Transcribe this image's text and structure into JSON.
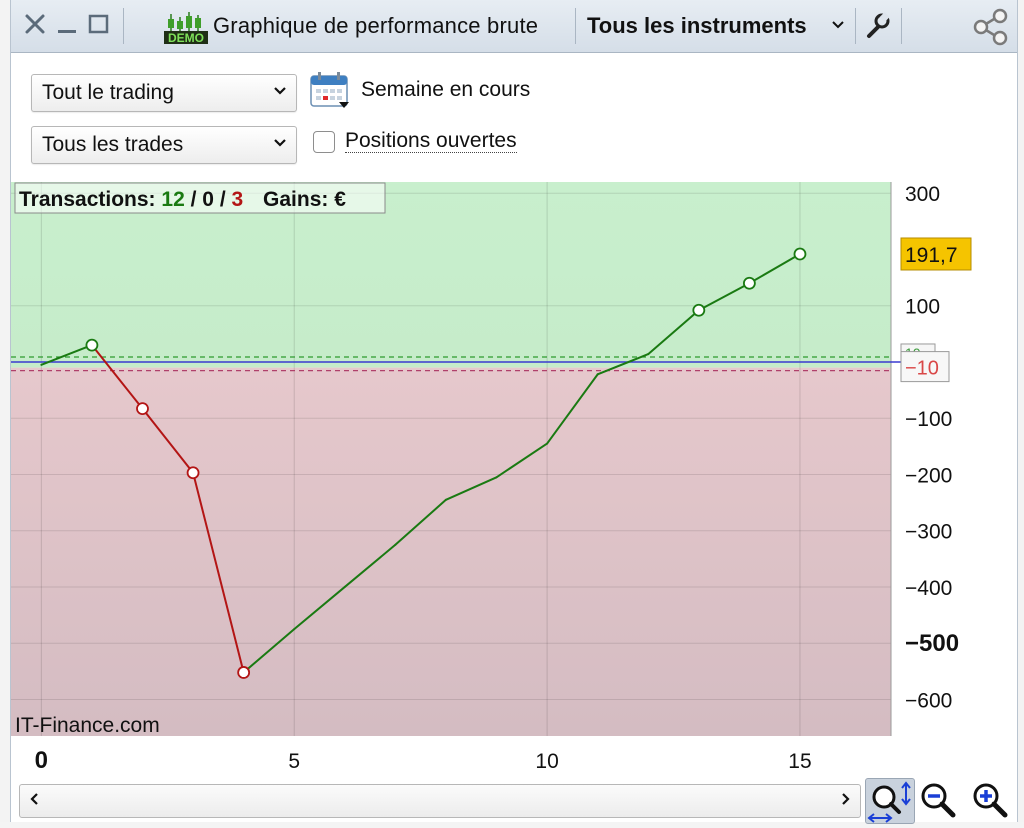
{
  "titlebar": {
    "title": "Graphique de performance brute",
    "instrument_label": "Tous les instruments",
    "demo_badge": "DEMO"
  },
  "controls": {
    "trading_select": "Tout le trading",
    "trades_select": "Tous les trades",
    "period_label": "Semaine en cours",
    "open_positions_label": "Positions ouvertes",
    "open_positions_checked": false
  },
  "summary": {
    "transactions_label": "Transactions:",
    "winning": "12",
    "neutral": "0",
    "losing": "3",
    "separator": "/",
    "gains_label": "Gains: €"
  },
  "watermark": "IT-Finance.com",
  "colors": {
    "profit_zone": "#c8efcd",
    "loss_zone": "#dcc2c8",
    "gain_line": "#1a7a12",
    "loss_line": "#b31515",
    "last_value_badge": "#f5c400",
    "reference_line": "#3a3ad0"
  },
  "chart_data": {
    "type": "line",
    "xlabel": "",
    "ylabel": "",
    "xlim": [
      -0.6,
      16.8
    ],
    "ylim": [
      -665,
      320
    ],
    "x_ticks": [
      "0",
      "5",
      "10",
      "15"
    ],
    "y_ticks": [
      "300",
      "100",
      "-100",
      "-200",
      "-300",
      "-400",
      "-500",
      "-600"
    ],
    "bold_x_ticks": [
      "0"
    ],
    "bold_y_ticks": [
      "-500"
    ],
    "grid": true,
    "series": [
      {
        "x": [
          0,
          1,
          2,
          3,
          4,
          5,
          6,
          7,
          8,
          9,
          10,
          11,
          12,
          13,
          14,
          15
        ],
        "y": [
          -5,
          30,
          -83,
          -197,
          -552,
          -475,
          -400,
          -325,
          -245,
          -205,
          -145,
          -22,
          14,
          92,
          140,
          192
        ]
      }
    ],
    "markers_x": [
      1,
      2,
      3,
      4,
      13,
      14,
      15
    ],
    "last_value": "191,7",
    "reference_value": "-10",
    "reference_label": "-10",
    "zero_line": 0,
    "hidden_badge": "10"
  }
}
